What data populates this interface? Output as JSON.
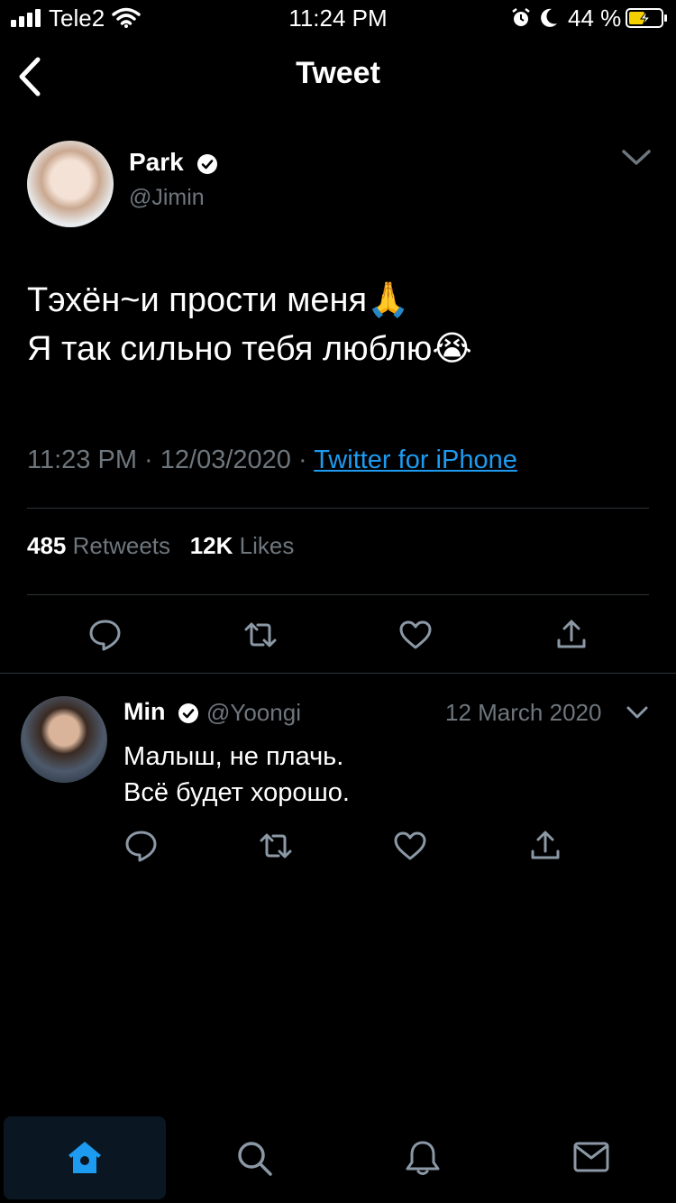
{
  "status_bar": {
    "carrier": "Tele2",
    "time": "11:24 PM",
    "battery": "44 %"
  },
  "header": {
    "title": "Tweet"
  },
  "tweet": {
    "author_name": "Park",
    "author_handle": "@Jimin",
    "text_line1": "Тэхён~и прости меня🙏",
    "text_line2": "Я так сильно тебя люблю😭",
    "time": "11:23 PM",
    "date": "12/03/2020",
    "source": "Twitter for iPhone",
    "retweet_count": "485",
    "retweet_label": "Retweets",
    "like_count": "12K",
    "like_label": "Likes"
  },
  "reply": {
    "author_name": "Min",
    "author_handle": "@Yoongi",
    "date": "12 March 2020",
    "text_line1": "Малыш, не плачь.",
    "text_line2": "Всё будет хорошо."
  },
  "colors": {
    "background": "#000000",
    "accent": "#1d9bf0",
    "muted": "#6e767d",
    "divider": "#2f3336"
  },
  "icons": [
    "back-chevron-icon",
    "verified-icon",
    "chevron-down-icon",
    "reply-icon",
    "retweet-icon",
    "like-icon",
    "share-icon",
    "home-icon",
    "search-icon",
    "notifications-icon",
    "messages-icon"
  ]
}
